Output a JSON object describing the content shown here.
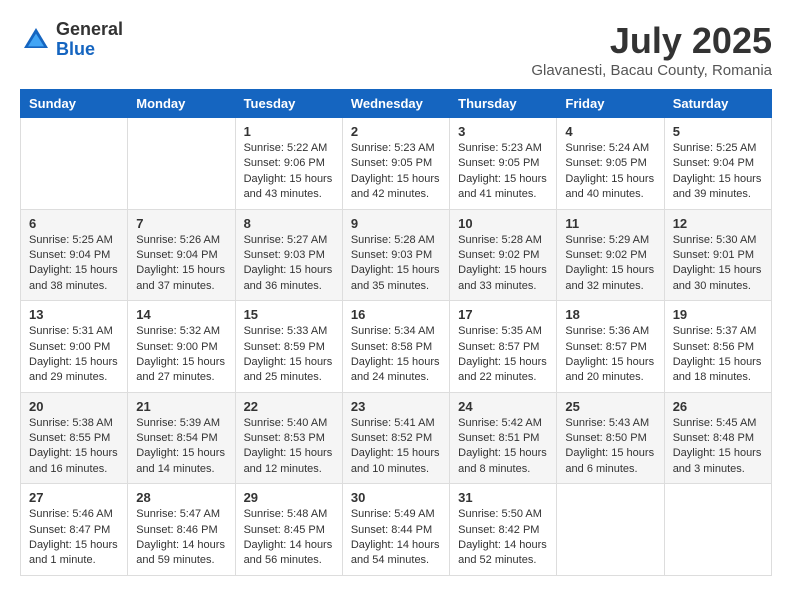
{
  "logo": {
    "general": "General",
    "blue": "Blue"
  },
  "title": "July 2025",
  "location": "Glavanesti, Bacau County, Romania",
  "days_of_week": [
    "Sunday",
    "Monday",
    "Tuesday",
    "Wednesday",
    "Thursday",
    "Friday",
    "Saturday"
  ],
  "weeks": [
    [
      {
        "day": "",
        "info": ""
      },
      {
        "day": "",
        "info": ""
      },
      {
        "day": "1",
        "info": "Sunrise: 5:22 AM\nSunset: 9:06 PM\nDaylight: 15 hours and 43 minutes."
      },
      {
        "day": "2",
        "info": "Sunrise: 5:23 AM\nSunset: 9:05 PM\nDaylight: 15 hours and 42 minutes."
      },
      {
        "day": "3",
        "info": "Sunrise: 5:23 AM\nSunset: 9:05 PM\nDaylight: 15 hours and 41 minutes."
      },
      {
        "day": "4",
        "info": "Sunrise: 5:24 AM\nSunset: 9:05 PM\nDaylight: 15 hours and 40 minutes."
      },
      {
        "day": "5",
        "info": "Sunrise: 5:25 AM\nSunset: 9:04 PM\nDaylight: 15 hours and 39 minutes."
      }
    ],
    [
      {
        "day": "6",
        "info": "Sunrise: 5:25 AM\nSunset: 9:04 PM\nDaylight: 15 hours and 38 minutes."
      },
      {
        "day": "7",
        "info": "Sunrise: 5:26 AM\nSunset: 9:04 PM\nDaylight: 15 hours and 37 minutes."
      },
      {
        "day": "8",
        "info": "Sunrise: 5:27 AM\nSunset: 9:03 PM\nDaylight: 15 hours and 36 minutes."
      },
      {
        "day": "9",
        "info": "Sunrise: 5:28 AM\nSunset: 9:03 PM\nDaylight: 15 hours and 35 minutes."
      },
      {
        "day": "10",
        "info": "Sunrise: 5:28 AM\nSunset: 9:02 PM\nDaylight: 15 hours and 33 minutes."
      },
      {
        "day": "11",
        "info": "Sunrise: 5:29 AM\nSunset: 9:02 PM\nDaylight: 15 hours and 32 minutes."
      },
      {
        "day": "12",
        "info": "Sunrise: 5:30 AM\nSunset: 9:01 PM\nDaylight: 15 hours and 30 minutes."
      }
    ],
    [
      {
        "day": "13",
        "info": "Sunrise: 5:31 AM\nSunset: 9:00 PM\nDaylight: 15 hours and 29 minutes."
      },
      {
        "day": "14",
        "info": "Sunrise: 5:32 AM\nSunset: 9:00 PM\nDaylight: 15 hours and 27 minutes."
      },
      {
        "day": "15",
        "info": "Sunrise: 5:33 AM\nSunset: 8:59 PM\nDaylight: 15 hours and 25 minutes."
      },
      {
        "day": "16",
        "info": "Sunrise: 5:34 AM\nSunset: 8:58 PM\nDaylight: 15 hours and 24 minutes."
      },
      {
        "day": "17",
        "info": "Sunrise: 5:35 AM\nSunset: 8:57 PM\nDaylight: 15 hours and 22 minutes."
      },
      {
        "day": "18",
        "info": "Sunrise: 5:36 AM\nSunset: 8:57 PM\nDaylight: 15 hours and 20 minutes."
      },
      {
        "day": "19",
        "info": "Sunrise: 5:37 AM\nSunset: 8:56 PM\nDaylight: 15 hours and 18 minutes."
      }
    ],
    [
      {
        "day": "20",
        "info": "Sunrise: 5:38 AM\nSunset: 8:55 PM\nDaylight: 15 hours and 16 minutes."
      },
      {
        "day": "21",
        "info": "Sunrise: 5:39 AM\nSunset: 8:54 PM\nDaylight: 15 hours and 14 minutes."
      },
      {
        "day": "22",
        "info": "Sunrise: 5:40 AM\nSunset: 8:53 PM\nDaylight: 15 hours and 12 minutes."
      },
      {
        "day": "23",
        "info": "Sunrise: 5:41 AM\nSunset: 8:52 PM\nDaylight: 15 hours and 10 minutes."
      },
      {
        "day": "24",
        "info": "Sunrise: 5:42 AM\nSunset: 8:51 PM\nDaylight: 15 hours and 8 minutes."
      },
      {
        "day": "25",
        "info": "Sunrise: 5:43 AM\nSunset: 8:50 PM\nDaylight: 15 hours and 6 minutes."
      },
      {
        "day": "26",
        "info": "Sunrise: 5:45 AM\nSunset: 8:48 PM\nDaylight: 15 hours and 3 minutes."
      }
    ],
    [
      {
        "day": "27",
        "info": "Sunrise: 5:46 AM\nSunset: 8:47 PM\nDaylight: 15 hours and 1 minute."
      },
      {
        "day": "28",
        "info": "Sunrise: 5:47 AM\nSunset: 8:46 PM\nDaylight: 14 hours and 59 minutes."
      },
      {
        "day": "29",
        "info": "Sunrise: 5:48 AM\nSunset: 8:45 PM\nDaylight: 14 hours and 56 minutes."
      },
      {
        "day": "30",
        "info": "Sunrise: 5:49 AM\nSunset: 8:44 PM\nDaylight: 14 hours and 54 minutes."
      },
      {
        "day": "31",
        "info": "Sunrise: 5:50 AM\nSunset: 8:42 PM\nDaylight: 14 hours and 52 minutes."
      },
      {
        "day": "",
        "info": ""
      },
      {
        "day": "",
        "info": ""
      }
    ]
  ]
}
